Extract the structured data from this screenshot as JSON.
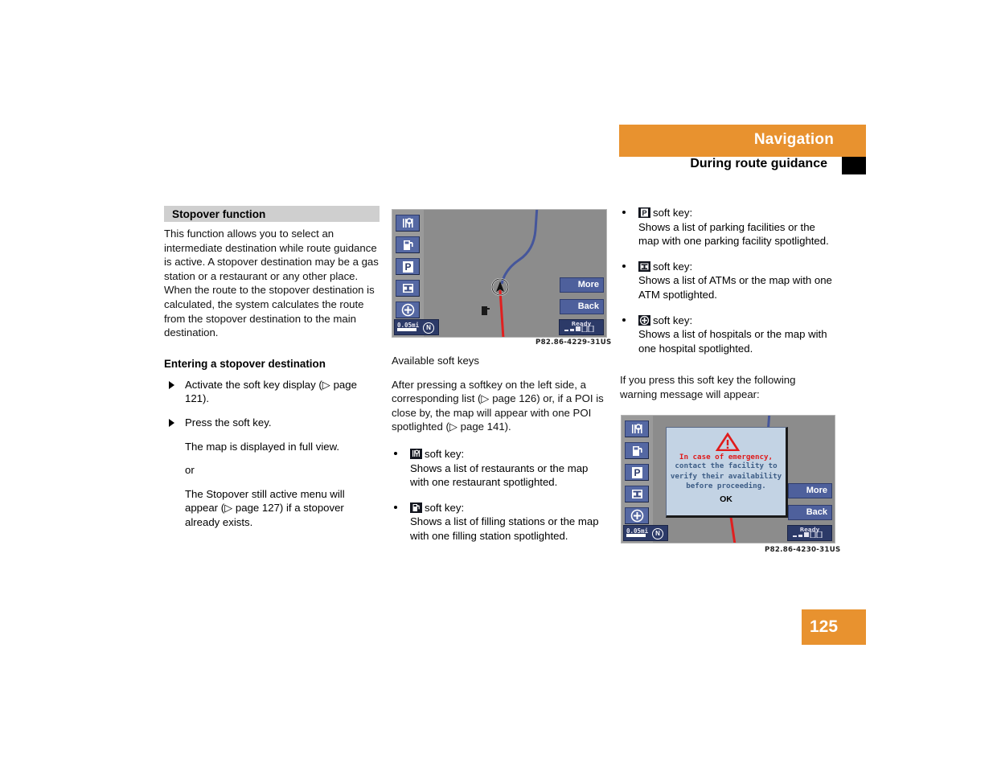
{
  "header": {
    "title": "Navigation",
    "subtitle": "During route guidance",
    "accent_color": "#e8922f",
    "marker_color": "#000000"
  },
  "page_number": "125",
  "left_column": {
    "section_title": "Stopover function",
    "intro_paragraph": "This function allows you to select an intermediate destination while route guidance is active. A stopover destination may be a gas station or a restaurant or any other place. When the route to the stopover destination is calculated, the system calculates the route from the stopover destination to the main destination.",
    "sub_heading": "Entering a stopover destination",
    "steps": [
      "Activate the soft key display (▷ page 121).",
      "Press the                soft key."
    ],
    "after_step_lines": [
      "The map is displayed in full view.",
      "or",
      "The Stopover still active menu will appear (▷ page 127) if a stopover already exists."
    ]
  },
  "middle_column": {
    "image_caption": "P82.86-4229-31US",
    "heading": "Available soft keys",
    "paragraph": "After pressing a softkey on the left side, a corresponding list (▷ page 126) or, if a POI is close by, the map will appear with one POI spotlighted (▷ page 141).",
    "bullets": [
      {
        "icon": "restaurant-icon",
        "label_suffix": "soft key:",
        "description": "Shows a list of restaurants or the map with one restaurant spotlighted."
      },
      {
        "icon": "fuel-pump-icon",
        "label_suffix": "soft key:",
        "description": "Shows a list of filling stations or the map with one filling station spotlighted."
      }
    ]
  },
  "right_column": {
    "bullets": [
      {
        "icon": "parking-icon",
        "label_suffix": "soft key:",
        "description": "Shows a list of parking facilities or the map with one parking facility spotlighted."
      },
      {
        "icon": "atm-icon",
        "label_suffix": "soft key:",
        "description": "Shows a list of ATMs or the map with one ATM spotlighted."
      },
      {
        "icon": "hospital-icon",
        "label_suffix": "soft key:",
        "description": "Shows a list of hospitals or the map with one hospital spotlighted."
      }
    ],
    "paragraph": "If you press this soft key the following warning message will appear:",
    "image_caption": "P82.86-4230-31US"
  },
  "nav_screen": {
    "softkeys": [
      "restaurant-icon",
      "fuel-pump-icon",
      "parking-icon",
      "atm-icon",
      "hospital-icon"
    ],
    "more_button": "More",
    "back_button": "Back",
    "scale": "0.05mi",
    "compass": "N",
    "status": "Ready",
    "map_bg_color": "#8c8c8c",
    "route_done_color": "#45569b",
    "route_active_color": "#e02020",
    "softkey_color": "#5568a3"
  },
  "warning_dialog": {
    "icon": "warning-triangle-icon",
    "lines": [
      "In case of emergency,",
      "contact the facility to",
      "verify their availability",
      "before proceeding."
    ],
    "ok_button": "OK",
    "emphasis_color": "#e01b1b",
    "text_color": "#3d5d86",
    "background_color": "#c3d3e4"
  }
}
